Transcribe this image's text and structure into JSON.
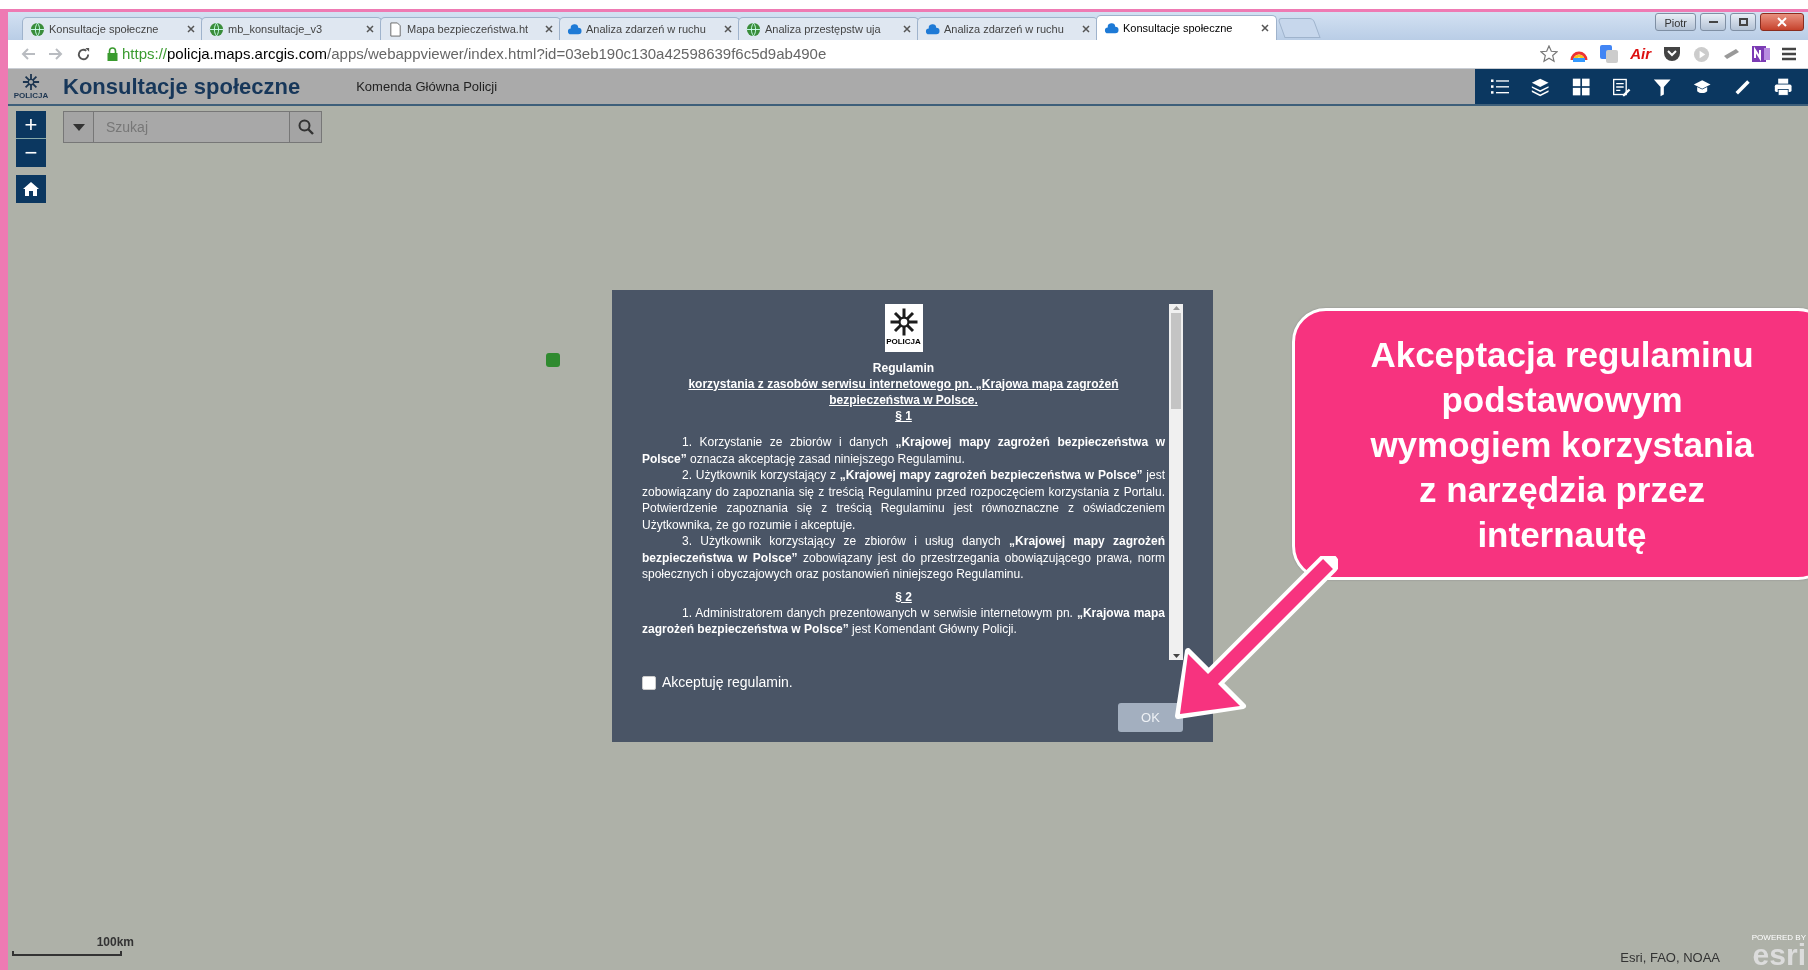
{
  "browser": {
    "tabs": [
      {
        "title": "Konsultacje społeczne",
        "kind": "globe",
        "selected": false
      },
      {
        "title": "mb_konsultacje_v3",
        "kind": "globe",
        "selected": false
      },
      {
        "title": "Mapa bezpieczeństwa.ht",
        "kind": "page",
        "selected": false
      },
      {
        "title": "Analiza zdarzeń w ruchu",
        "kind": "cloud",
        "selected": false
      },
      {
        "title": "Analiza przestępstw uja",
        "kind": "globe",
        "selected": false
      },
      {
        "title": "Analiza zdarzeń w ruchu",
        "kind": "cloud",
        "selected": false
      },
      {
        "title": "Konsultacje społeczne",
        "kind": "cloud",
        "selected": true
      }
    ],
    "profile": "Piotr",
    "url_scheme": "https://",
    "url_host": "policja.maps.arcgis.com",
    "url_path": "/apps/webappviewer/index.html?id=03eb190c130a42598639f6c5d9ab490e",
    "extension_label": "Air"
  },
  "app": {
    "logo_text": "POLICJA",
    "title": "Konsultacje społeczne",
    "subtitle": "Komenda Główna Policji",
    "tools": [
      {
        "kind": "list"
      },
      {
        "kind": "layers"
      },
      {
        "kind": "grid"
      },
      {
        "kind": "edit"
      },
      {
        "kind": "filter"
      },
      {
        "kind": "cap"
      },
      {
        "kind": "ruler"
      },
      {
        "kind": "print"
      }
    ]
  },
  "map": {
    "zoom_in": "+",
    "zoom_out": "−",
    "search": {
      "placeholder": "Szukaj"
    },
    "scale_label": "100km",
    "attribution": "Esri, FAO, NOAA",
    "powered_by": "POWERED BY",
    "esri_logo": "esri"
  },
  "dialog": {
    "logo_text": "POLICJA",
    "title": "Regulamin",
    "subtitle": "korzystania z zasobów serwisu internetowego pn. „Krajowa mapa zagrożeń bezpieczeństwa w Polsce.",
    "sections": [
      {
        "heading": "§ 1",
        "paragraphs": [
          "1. Korzystanie ze zbiorów i danych **„Krajowej mapy zagrożeń bezpieczeństwa w Polsce”** oznacza akceptację zasad niniejszego Regulaminu.",
          "2. Użytkownik korzystający z **„Krajowej mapy zagrożeń bezpieczeństwa w Polsce”** jest zobowiązany do zapoznania się z treścią Regulaminu przed rozpoczęciem korzystania z Portalu. Potwierdzenie zapoznania się z treścią Regulaminu jest równoznaczne z oświadczeniem Użytkownika, że go rozumie i akceptuje.",
          "3. Użytkownik korzystający ze zbiorów i usług danych **„Krajowej mapy zagrożeń bezpieczeństwa w Polsce”** zobowiązany jest do przestrzegania obowiązującego prawa, norm społecznych i obyczajowych oraz postanowień niniejszego Regulaminu."
        ]
      },
      {
        "heading": "§ 2",
        "paragraphs": [
          "1. Administratorem danych prezentowanych w serwisie internetowym pn. **„Krajowa mapa zagrożeń bezpieczeństwa w Polsce”** jest Komendant Główny Policji."
        ]
      }
    ],
    "checkbox": {
      "label": "Akceptuję regulamin.",
      "checked": false
    },
    "ok_button": {
      "label": "OK",
      "disabled": true
    }
  },
  "callout": {
    "text": "Akceptacja regulaminu podstawowym wymogiem korzystania z narzędzia przez internautę"
  }
}
